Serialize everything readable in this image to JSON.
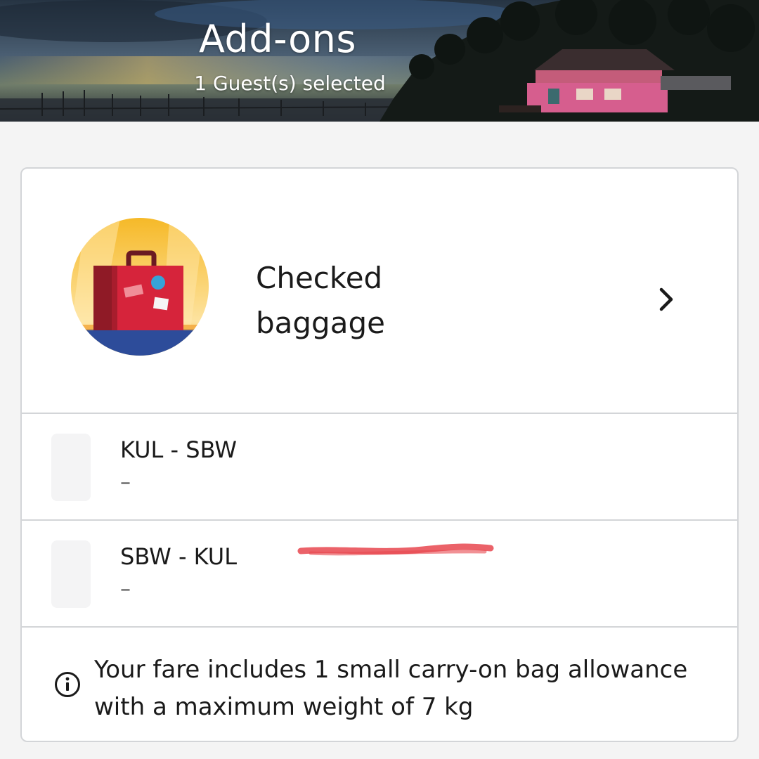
{
  "header": {
    "title": "Add-ons",
    "subtitle": "1 Guest(s) selected"
  },
  "checked_baggage": {
    "title_line1": "Checked",
    "title_line2": "baggage",
    "icon": "suitcase-icon",
    "chevron": "chevron-right-icon"
  },
  "routes": [
    {
      "label": "KUL - SBW",
      "value": "–"
    },
    {
      "label": "SBW - KUL",
      "value": "–"
    }
  ],
  "info": {
    "icon": "info-icon",
    "text": "Your fare includes 1 small carry-on bag allowance with a maximum weight of 7 kg",
    "highlight_color": "#e8474f"
  },
  "colors": {
    "background": "#f4f4f4",
    "card": "#ffffff",
    "divider": "#d3d5d8",
    "suitcase": "#d6243b",
    "circle_top": "#f7c13e",
    "circle_bottom": "#2d4c9a"
  }
}
